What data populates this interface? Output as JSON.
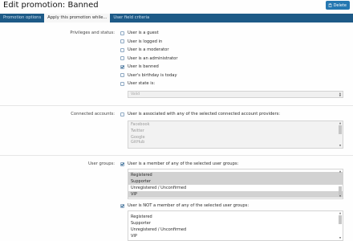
{
  "page": {
    "title": "Edit promotion: Banned",
    "delete_label": "Delete"
  },
  "tabs": [
    {
      "label": "Promotion options",
      "active": false
    },
    {
      "label": "Apply this promotion while...",
      "active": true
    },
    {
      "label": "User field criteria",
      "active": false
    }
  ],
  "privileges": {
    "label": "Privileges and status:",
    "options": [
      {
        "label": "User is a guest",
        "checked": false
      },
      {
        "label": "User is logged in",
        "checked": false
      },
      {
        "label": "User is a moderator",
        "checked": false
      },
      {
        "label": "User is an administrator",
        "checked": false
      },
      {
        "label": "User is banned",
        "checked": true
      },
      {
        "label": "User's birthday is today",
        "checked": false
      },
      {
        "label": "User state is:",
        "checked": false
      }
    ],
    "state_select_value": "Valid"
  },
  "connected": {
    "label": "Connected accounts:",
    "checkbox_label": "User is associated with any of the selected connected account providers:",
    "checked": false,
    "providers": [
      "Facebook",
      "Twitter",
      "Google",
      "GitHub"
    ]
  },
  "user_groups": {
    "label": "User groups:",
    "member_label": "User is a member of any of the selected user groups:",
    "member_checked": true,
    "member_items": [
      {
        "label": "Registered",
        "selected": true
      },
      {
        "label": "Supporter",
        "selected": true
      },
      {
        "label": "Unregistered / Unconfirmed",
        "selected": false
      },
      {
        "label": "VIP",
        "selected": true
      }
    ],
    "not_member_label": "User is NOT a member of any of the selected user groups:",
    "not_member_checked": true,
    "not_member_items": [
      {
        "label": "Registered",
        "selected": false
      },
      {
        "label": "Supporter",
        "selected": false
      },
      {
        "label": "Unregistered / Unconfirmed",
        "selected": false
      },
      {
        "label": "VIP",
        "selected": false
      }
    ]
  },
  "colors": {
    "accent": "#2577b1",
    "tabbar": "#1d5a87"
  }
}
